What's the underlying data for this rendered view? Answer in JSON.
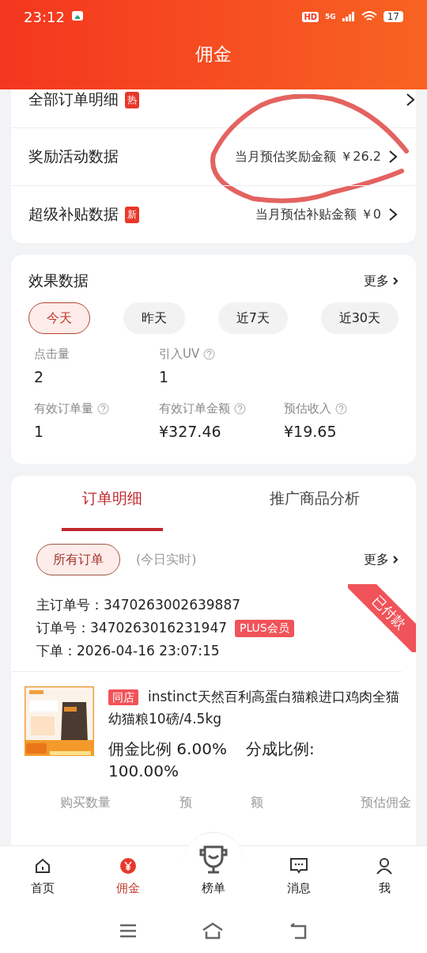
{
  "status_bar": {
    "time": "23:12",
    "hd": "HD",
    "network": "5G",
    "battery": "17"
  },
  "header": {
    "title": "佣金"
  },
  "entries": [
    {
      "label": "全部订单明细",
      "badge": "热"
    },
    {
      "label": "奖励活动数据",
      "value": "当月预估奖励金额 ￥26.2",
      "circled": true
    },
    {
      "label": "超级补贴数据",
      "badge": "新",
      "value": "当月预估补贴金额 ￥0"
    }
  ],
  "effect": {
    "title": "效果数据",
    "more": "更多",
    "periods": [
      {
        "label": "今天",
        "selected": true
      },
      {
        "label": "昨天",
        "selected": false
      },
      {
        "label": "近7天",
        "selected": false
      },
      {
        "label": "近30天",
        "selected": false
      }
    ],
    "metric_rows": [
      [
        {
          "label": "点击量",
          "value": "2",
          "help": false
        },
        {
          "label": "引入UV",
          "value": "1",
          "help": true
        }
      ],
      [
        {
          "label": "有效订单量",
          "value": "1",
          "help": true
        },
        {
          "label": "有效订单金额",
          "value": "¥327.46",
          "help": true
        },
        {
          "label": "预估收入",
          "value": "¥19.65",
          "help": true
        }
      ]
    ]
  },
  "orders": {
    "tabs": [
      {
        "label": "订单明细",
        "selected": true
      },
      {
        "label": "推广商品分析",
        "selected": false
      }
    ],
    "filter": {
      "label": "所有订单",
      "selected": true
    },
    "note": "(今日实时)",
    "more": "更多",
    "order": {
      "status": "已付款",
      "lines": [
        {
          "label": "主订单号：",
          "value": "3470263002639887"
        },
        {
          "label": "订单号：",
          "value": "3470263016231947",
          "tag": "PLUS会员"
        },
        {
          "label": "下单：",
          "value": "2026-04-16 23:07:15"
        }
      ],
      "product": {
        "kind": "picture",
        "shop_tag": "同店",
        "title": "instinct天然百利高蛋白猫粮进口鸡肉全猫幼猫粮10磅/4.5kg",
        "commission_label": "佣金比例",
        "commission": "6.00%",
        "share_label": "分成比例:",
        "share": "100.00%"
      },
      "summary_labels": [
        "购买数量",
        "预",
        "额",
        "预估佣金"
      ]
    }
  },
  "tab_bar": [
    {
      "label": "首页",
      "kind": "home",
      "selected": false
    },
    {
      "label": "佣金",
      "kind": "yen",
      "selected": true
    },
    {
      "label": "榜单",
      "kind": "trophy",
      "selected": false
    },
    {
      "label": "消息",
      "kind": "message",
      "selected": false
    },
    {
      "label": "我",
      "kind": "person",
      "selected": false
    }
  ]
}
